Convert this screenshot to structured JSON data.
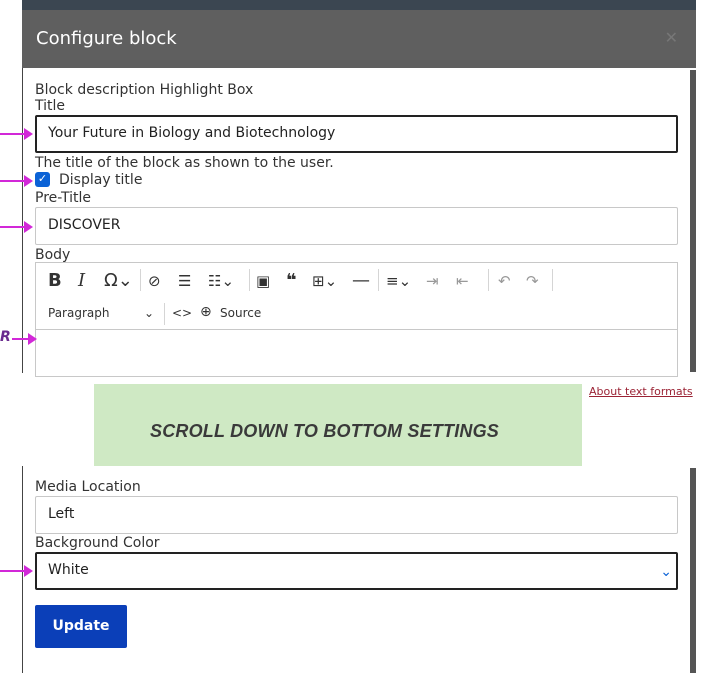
{
  "modal": {
    "title": "Configure block",
    "close_icon": "close-icon"
  },
  "form": {
    "block_description": "Block description Highlight Box",
    "title_label": "Title",
    "title_value": "Your Future in Biology and Biotechnology",
    "title_help": "The title of the block as shown to the user.",
    "display_title_label": "Display title",
    "display_title_checked": true,
    "pretitle_label": "Pre-Title",
    "pretitle_value": "DISCOVER",
    "body_label": "Body",
    "about_text_formats": "About text formats"
  },
  "editor_toolbar": {
    "row1": [
      "bold-icon",
      "italic-icon",
      "special-chars-icon",
      "link-icon",
      "bulleted-list-icon",
      "numbered-list-icon",
      "image-icon",
      "blockquote-icon",
      "table-icon",
      "horizontal-line-icon",
      "align-icon",
      "indent-icon",
      "outdent-icon",
      "undo-icon",
      "redo-icon"
    ],
    "paragraph_select": "Paragraph",
    "source_label": "Source"
  },
  "callout": {
    "text": "SCROLL DOWN TO BOTTOM SETTINGS",
    "color": "#cfe9c4"
  },
  "bottom": {
    "media_location_label": "Media Location",
    "media_location_value": "Left",
    "background_color_label": "Background Color",
    "background_color_value": "White",
    "update_label": "Update"
  },
  "colors": {
    "header_bg": "#5f5f5f",
    "primary_button": "#0b3fb8",
    "checkbox": "#0b62d6",
    "annotation_arrow": "#d228d8"
  },
  "edge_letter": "R"
}
